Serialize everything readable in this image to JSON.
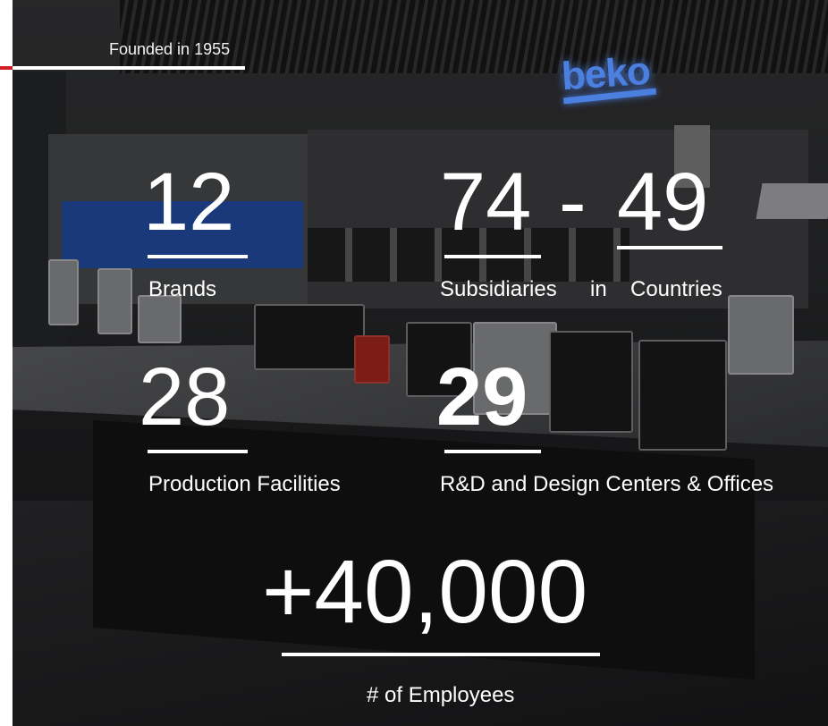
{
  "header": {
    "founded": "Founded in 1955"
  },
  "brand": {
    "logo_text": "beko",
    "accent_color": "#d11f26",
    "logo_color": "#4b7fe0"
  },
  "stats": {
    "brands": {
      "value": "12",
      "label": "Brands"
    },
    "subsidiaries": {
      "value": "74",
      "separator": "-",
      "value2": "49",
      "label1": "Subsidiaries",
      "label_in": "in",
      "label2": "Countries"
    },
    "production": {
      "value": "28",
      "label": "Production Facilities"
    },
    "rnd": {
      "value": "29",
      "label": "R&D and Design Centers & Offices"
    },
    "employees": {
      "value": "+40,000",
      "label": "# of Employees"
    }
  }
}
